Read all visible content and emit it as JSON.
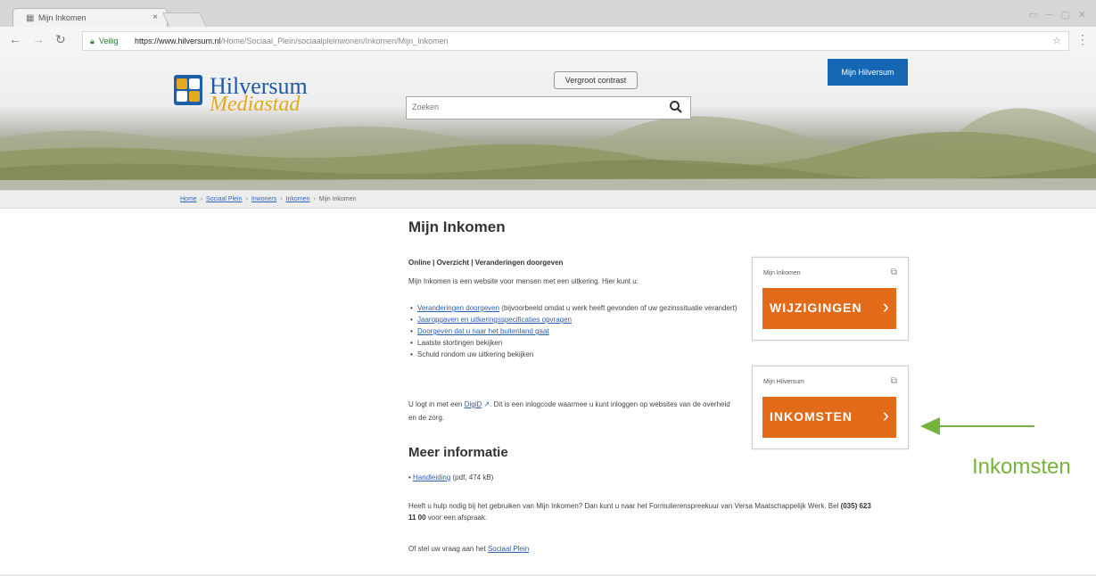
{
  "browser": {
    "tab_title": "Mijn Inkomen",
    "tab_close": "×",
    "secure_label": "Veilig",
    "url_domain": "https://www.hilversum.nl",
    "url_path": "/Home/Sociaal_Plein/sociaalpleinwonen/Inkomen/Mijn_Inkomen",
    "window_controls": "▭ ─ ▢ ✕"
  },
  "header": {
    "logo_line1": "Hilversum",
    "logo_line2": "Mediastad",
    "contrast_button": "Vergroot contrast",
    "search_placeholder": "Zoeken",
    "mijn_hilversum_button": "Mijn Hilversum",
    "colors": {
      "logo_blue": "#1e5aa4",
      "logo_gold": "#e3a81b",
      "button_blue": "#1567b4"
    }
  },
  "breadcrumb": {
    "items": [
      "Home",
      "Sociaal Plein",
      "Inwoners",
      "Inkomen"
    ],
    "current": "Mijn Inkomen"
  },
  "main": {
    "title": "Mijn Inkomen",
    "subhead": "Online | Overzicht | Veranderingen doorgeven",
    "intro": "Mijn Inkomen is een website voor mensen met een uitkering. Hier kunt u:",
    "bullets": [
      {
        "link": "Veranderingen doorgeven",
        "rest": " (bijvoorbeeld omdat u werk heeft gevonden of uw gezinssituatie verandert)"
      },
      {
        "link": "Jaaropgaven en uitkeringsspecificaties opvragen",
        "rest": ""
      },
      {
        "link": "Doorgeven dat u naar het buitenland gaat",
        "rest": ""
      },
      {
        "link": "",
        "rest": "Laatste stortingen bekijken"
      },
      {
        "link": "",
        "rest": "Schuld rondom uw uitkering bekijken"
      }
    ],
    "digid_before": "U logt in met een ",
    "digid_link": "DigiD",
    "digid_after": ". Dit is een inlogcode waarmee u kunt inloggen op websites van de overheid en de zorg.",
    "meer_title": "Meer informatie",
    "handleiding_link": "Handleiding",
    "handleiding_meta": " (pdf, 474 kB)",
    "hulp_text": "Heeft u hulp nodig bij het gebruiken van Mijn Inkomen? Dan kunt u naar het Formulierenspreekuur van Versa Maatschappelijk Werk. Bel ",
    "hulp_phone": "(035) 623 11 00",
    "hulp_after": " voor een afspraak.",
    "vraag_before": "Of stel uw vraag aan het ",
    "vraag_link": "Sociaal Plein"
  },
  "cards": [
    {
      "label": "Mijn Inkomen",
      "button": "WIJZIGINGEN",
      "icon": "external-link-icon"
    },
    {
      "label": "Mijn Hilversum",
      "button": "INKOMSTEN",
      "icon": "external-link-icon"
    }
  ],
  "annotation": {
    "label": "Inkomsten",
    "color": "#77b23a"
  },
  "colors": {
    "orange_button": "#e26b1a",
    "link_blue": "#2a5fb0"
  }
}
